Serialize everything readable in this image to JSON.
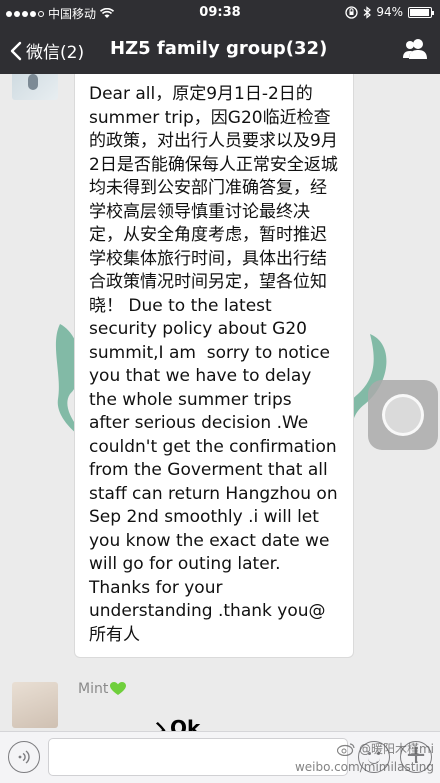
{
  "status_bar": {
    "carrier": "中国移动",
    "time": "09:38",
    "battery": "94%",
    "battery_level": 0.94
  },
  "nav": {
    "back_label": "微信(2)",
    "title": "HZ5 family group(32)"
  },
  "message": {
    "text": "Dear all，原定9月1日-2日的summer trip，因G20临近检查的政策，对出行人员要求以及9月2日是否能确保每人正常安全返城均未得到公安部门准确答复，经学校高层领导慎重讨论最终决定，从安全角度考虑，暂时推迟学校集体旅行时间，具体出行结合政策情况时间另定，望各位知晓！ Due to the latest security policy about G20 summit,I am  sorry to notice you that we have to delay the whole summer trips  after serious decision .We couldn't get the confirmation from the Goverment that all staff can return Hangzhou on  Sep 2nd smoothly .i will let you know the exact date we will go for outing later. Thanks for your understanding .thank you@所有人"
  },
  "next_message": {
    "sender": "Mint",
    "preview": "ゝOk"
  },
  "watermark": {
    "line1": "@暖阳木槿mi",
    "line2": "weibo.com/mimilasting"
  }
}
